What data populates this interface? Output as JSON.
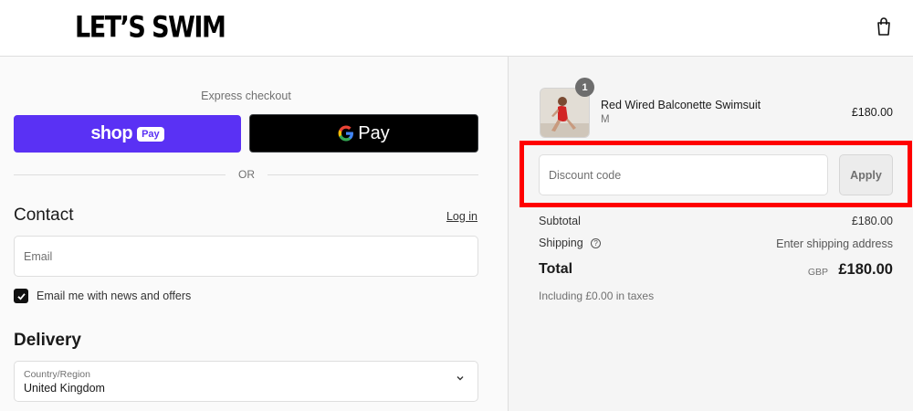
{
  "header": {
    "logo": "LET’S SWIM",
    "cart_icon": "shopping-bag-icon"
  },
  "checkout": {
    "express_label": "Express checkout",
    "shop_pay": {
      "shop": "shop",
      "pay": "Pay"
    },
    "gpay": {
      "g": "G",
      "pay": "Pay"
    },
    "or_text": "OR",
    "contact": {
      "heading": "Contact",
      "login_link": "Log in",
      "email_placeholder": "Email",
      "email_value": "",
      "newsletter_checked": true,
      "newsletter_label": "Email me with news and offers"
    },
    "delivery": {
      "heading": "Delivery",
      "country_label": "Country/Region",
      "country_value": "United Kingdom"
    }
  },
  "summary": {
    "product": {
      "name": "Red Wired Balconette Swimsuit",
      "variant": "M",
      "quantity": "1",
      "price": "£180.00"
    },
    "discount": {
      "placeholder": "Discount code",
      "apply_label": "Apply"
    },
    "subtotal_label": "Subtotal",
    "subtotal_value": "£180.00",
    "shipping_label": "Shipping",
    "shipping_value": "Enter shipping address",
    "total_label": "Total",
    "total_currency": "GBP",
    "total_value": "£180.00",
    "taxes_note": "Including £0.00 in taxes"
  },
  "colors": {
    "shop_pay": "#5a31f4",
    "gpay": "#000000",
    "highlight": "#ff0000"
  }
}
